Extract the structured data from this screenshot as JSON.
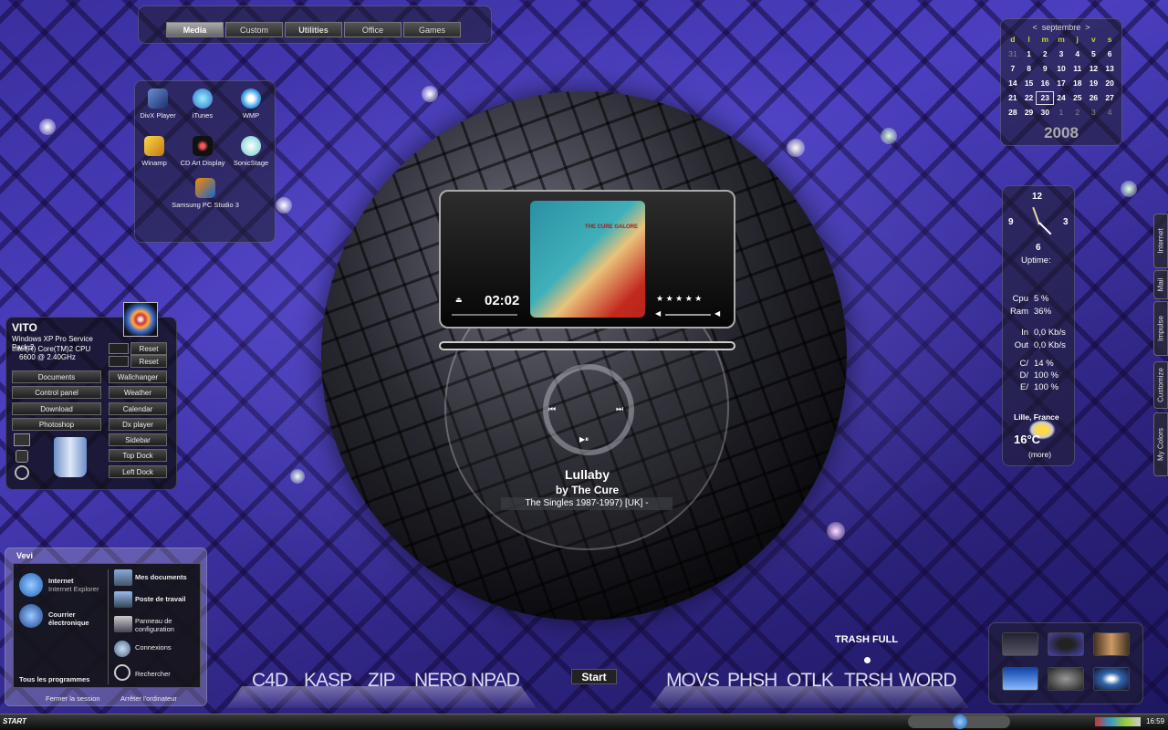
{
  "top_tabs": [
    "Media",
    "Custom",
    "Utilities",
    "Office",
    "Games"
  ],
  "apps": [
    {
      "label": "DivX Player",
      "icon": "divx-icon"
    },
    {
      "label": "iTunes",
      "icon": "itunes-icon"
    },
    {
      "label": "WMP",
      "icon": "wmp-icon"
    },
    {
      "label": "Winamp",
      "icon": "winamp-icon"
    },
    {
      "label": "CD Art Display",
      "icon": "cd-art-icon"
    },
    {
      "label": "SonicStage",
      "icon": "sonicstage-icon"
    },
    {
      "label": "Samsung PC Studio 3",
      "icon": "samsung-icon"
    }
  ],
  "calendar": {
    "month": "septembre",
    "prev": "<",
    "next": ">",
    "dow": [
      "d",
      "l",
      "m",
      "m",
      "j",
      "v",
      "s"
    ],
    "days": [
      "31",
      "1",
      "2",
      "3",
      "4",
      "5",
      "6",
      "7",
      "8",
      "9",
      "10",
      "11",
      "12",
      "13",
      "14",
      "15",
      "16",
      "17",
      "18",
      "19",
      "20",
      "21",
      "22",
      "23",
      "24",
      "25",
      "26",
      "27",
      "28",
      "29",
      "30",
      "1",
      "2",
      "3",
      "4"
    ],
    "year": "2008"
  },
  "clock": {
    "n12": "12",
    "n3": "3",
    "n6": "6",
    "n9": "9",
    "uptime": "Uptime:"
  },
  "stats": {
    "cpu": [
      "Cpu",
      "5 %"
    ],
    "ram": [
      "Ram",
      "36%"
    ],
    "in": [
      "In",
      "0,0 Kb/s"
    ],
    "out": [
      "Out",
      "0,0 Kb/s"
    ],
    "c": [
      "C/",
      "14 %"
    ],
    "d": [
      "D/",
      "100 %"
    ],
    "e": [
      "E/",
      "100 %"
    ]
  },
  "weather": {
    "city": "Lille, France",
    "temp": "16°C",
    "more": "(more)"
  },
  "side_tabs": [
    "Internet",
    "Mail",
    "Impulse",
    "Customize",
    "My Colors"
  ],
  "vito": {
    "name": "VITO",
    "os": "Windows XP Pro Service Pack 2",
    "cpu": "Intel(R) Core(TM)2 CPU",
    "freq": "6600  @ 2.40GHz",
    "reset1": "Reset",
    "reset2": "Reset",
    "left": [
      "Documents",
      "Control panel",
      "Download",
      "Photoshop"
    ],
    "right": [
      "Wallchanger",
      "Weather",
      "Calendar",
      "Dx player",
      "Sidebar",
      "Top Dock",
      "Left Dock"
    ]
  },
  "startmenu": {
    "user": "Vevi",
    "internet": "Internet",
    "internet_sub": "Internet Explorer",
    "mail": "Courrier",
    "mail_sub": "électronique",
    "all": "Tous les programmes",
    "docs": "Mes documents",
    "workstation": "Poste de travail",
    "panel1": "Panneau de",
    "panel2": "configuration",
    "conn": "Connexions",
    "search": "Rechercher",
    "logoff": "Fermer la session",
    "shutdown": "Arrêter l'ordinateur"
  },
  "player": {
    "time": "02:02",
    "stars": "★ ★ ★ ★ ★",
    "title": "Lullaby",
    "artist": "by The Cure",
    "album": "The Singles 1987-1997) [UK] -",
    "cover_text": "THE CURE GALORE"
  },
  "dock_left": [
    "C4D",
    "KASP",
    "ZIP",
    "NERO",
    "NPAD"
  ],
  "dock_right": [
    "MOVS",
    "PHSH",
    "OTLK",
    "TRSH",
    "WORD"
  ],
  "start_button": "Start",
  "trash": "TRASH FULL",
  "taskbar": {
    "start": "START",
    "time": "16:59"
  }
}
